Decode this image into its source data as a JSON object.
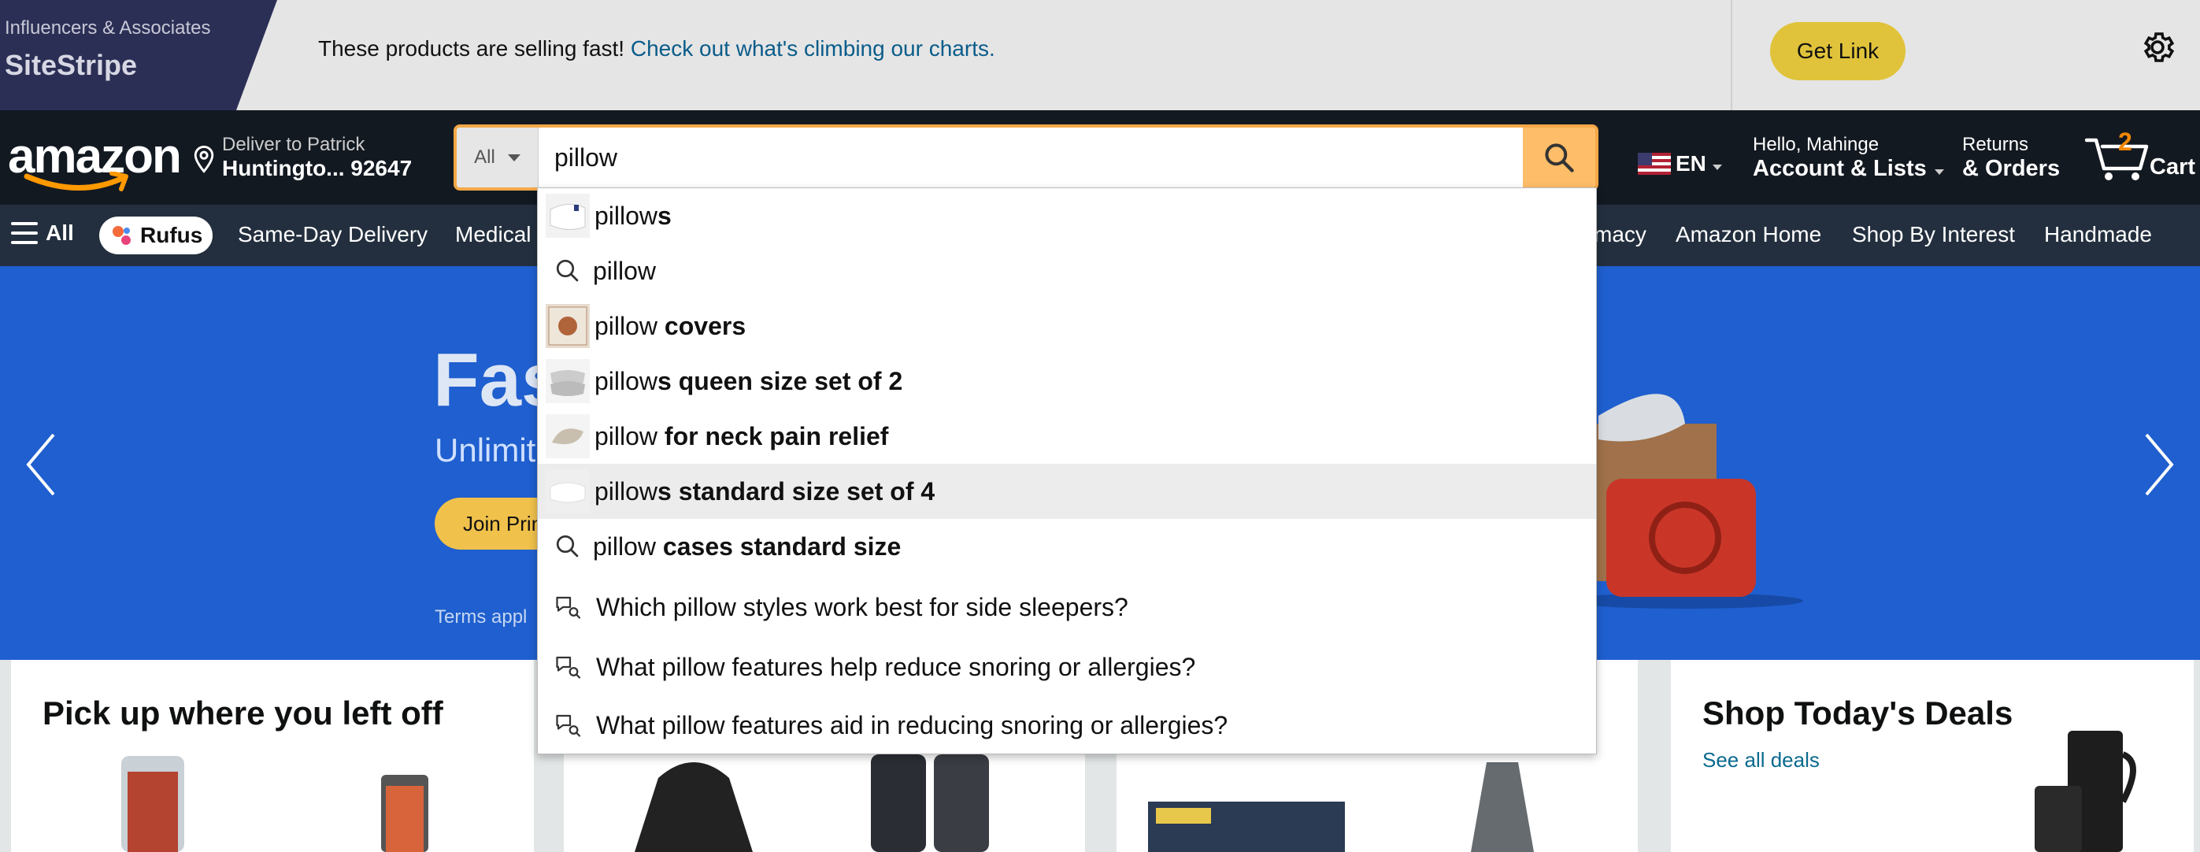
{
  "sitestripe": {
    "brand_sub": "Influencers & Associates",
    "brand_title": "SiteStripe",
    "message": "These products are selling fast!",
    "message_link": "Check out what's climbing our charts.",
    "get_link_label": "Get Link"
  },
  "header": {
    "logo_text": "amazon",
    "deliver_top": "Deliver to Patrick",
    "deliver_bottom": "Huntingto... 92647",
    "search_category": "All",
    "search_value": "pillow",
    "language": "EN",
    "account_top": "Hello, Mahinge",
    "account_bottom": "Account & Lists",
    "returns_top": "Returns",
    "returns_bottom": "& Orders",
    "cart_count": "2",
    "cart_label": "Cart"
  },
  "nav": {
    "all_label": "All",
    "rufus_label": "Rufus",
    "items": [
      "Same-Day Delivery",
      "Medical",
      "macy",
      "Amazon Home",
      "Shop By Interest",
      "Handmade"
    ]
  },
  "hero": {
    "title": "Fas",
    "subtitle": "Unlimit",
    "join_label": "Join Prin",
    "terms": "Terms appl"
  },
  "cards": {
    "left_title": "Pick up where you left off",
    "right_title": "Shop Today's Deals",
    "right_link": "See all deals"
  },
  "suggestions": [
    {
      "prefix": "pillow",
      "bold": "",
      "suffix_plain": "s",
      "type": "thumb"
    },
    {
      "prefix": "pillow",
      "bold": "",
      "suffix_plain": "",
      "type": "search"
    },
    {
      "prefix": "pillow ",
      "bold": "covers",
      "suffix_plain": "",
      "type": "thumb"
    },
    {
      "prefix": "pillow",
      "bold": "s queen size set of 2",
      "suffix_plain": "",
      "type": "thumb"
    },
    {
      "prefix": "pillow ",
      "bold": "for neck pain relief",
      "suffix_plain": "",
      "type": "thumb"
    },
    {
      "prefix": "pillow",
      "bold": "s standard size set of 4",
      "suffix_plain": "",
      "type": "thumb"
    },
    {
      "prefix": "pillow ",
      "bold": "cases standard size",
      "suffix_plain": "",
      "type": "search"
    },
    {
      "text": "Which pillow styles work best for side sleepers?",
      "type": "ai"
    },
    {
      "text": "What pillow features help reduce snoring or allergies?",
      "type": "ai"
    },
    {
      "text": "What pillow features aid in reducing snoring or allergies?",
      "type": "ai"
    }
  ],
  "colors": {
    "header_bg": "#131921",
    "nav_bg": "#232f3e",
    "search_button": "#febd69",
    "search_border": "#f3a847",
    "cart_count": "#f08804",
    "hero_bg": "#1f5fcf"
  }
}
